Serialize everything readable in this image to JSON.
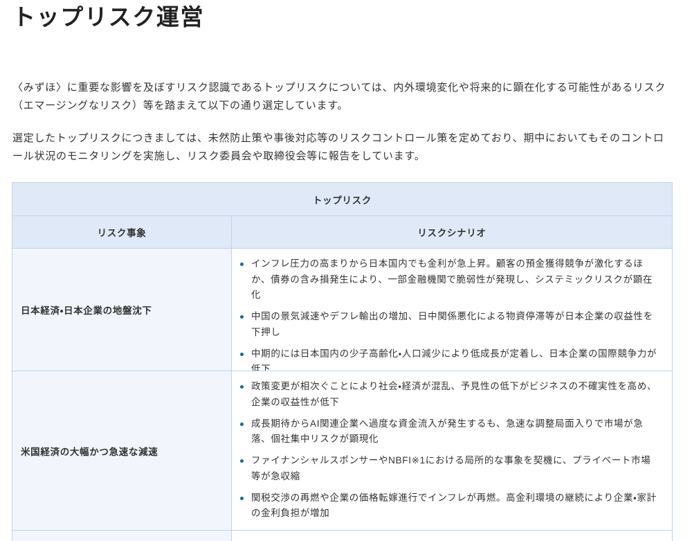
{
  "page": {
    "title": "トップリスク運営"
  },
  "intro": {
    "paragraph_1": "〈みずほ〉に重要な影響を及ぼすリスク認識であるトップリスクについては、内外環境変化や将来的に顕在化する可能性があるリスク（エマージングなリスク）等を踏まえて以下の通り選定しています。",
    "paragraph_2": "選定したトップリスクにつきましては、未然防止策や事後対応等のリスクコントロール策を定めており、期中においてもそのコントロール状況のモニタリングを実施し、リスク委員会や取締役会等に報告をしています。"
  },
  "table": {
    "caption": "トップリスク",
    "columns": [
      "リスク事象",
      "リスクシナリオ"
    ],
    "rows": [
      {
        "event": "日本経済・日本企業の地盤沈下",
        "scenarios": [
          "インフレ圧力の高まりから日本国内でも金利が急上昇。顧客の預金獲得競争が激化するほか、債券の含み損発生により、一部金融機関で脆弱性が発現し、システミックリスクが顕在化",
          "中国の景気減速やデフレ輸出の増加、日中関係悪化による物資停滞等が日本企業の収益性を下押し",
          "中期的には日本国内の少子高齢化・人口減少により低成長が定着し、日本企業の国際競争力が低下"
        ]
      },
      {
        "event": "米国経済の大幅かつ急速な減速",
        "scenarios": [
          "政策変更が相次ぐことにより社会・経済が混乱、予見性の低下がビジネスの不確実性を高め、企業の収益性が低下",
          "成長期待からAI関連企業へ過度な資金流入が発生するも、急速な調整局面入りで市場が急落、個社集中リスクが顕現化",
          "ファイナンシャルスポンサーやNBFI※1における局所的な事象を契機に、プライベート市場等が急収縮",
          "関税交渉の再燃や企業の価格転嫁進行でインフレが再燃。高金利環境の継続により企業・家計の金利負担が増加"
        ]
      }
    ]
  },
  "icons": {
    "list_bullet": "bullet-icon"
  },
  "colors": {
    "accent": "#1f5fae",
    "header_background": "#dfe9f8",
    "event_background": "#f2f6fc",
    "border": "#bfd2ec",
    "text": "#333333",
    "title": "#222222"
  }
}
